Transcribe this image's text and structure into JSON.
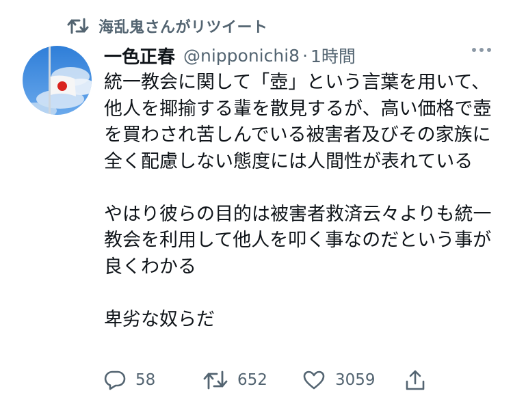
{
  "retweet_context": {
    "icon": "retweet-icon",
    "label": "海乱鬼さんがリツイート"
  },
  "author": {
    "avatar": "avatar-japanese-flag-on-pole",
    "display_name": "一色正春",
    "handle": "@nipponichi8",
    "separator": "·",
    "time": "1時間"
  },
  "more_menu": {
    "icon": "more-horizontal-icon"
  },
  "tweet": {
    "text": "統一教会に関して「壺」という言葉を用いて、他人を揶揄する輩を散見するが、高い価格で壺を買わされ苦しんでいる被害者及びその家族に全く配慮しない態度には人間性が表れている\n\nやはり彼らの目的は被害者救済云々よりも統一教会を利用して他人を叩く事なのだという事が良くわかる\n\n卑劣な奴らだ"
  },
  "actions": {
    "reply": {
      "icon": "reply-icon",
      "count": "58"
    },
    "retweet": {
      "icon": "retweet-icon",
      "count": "652"
    },
    "like": {
      "icon": "heart-icon",
      "count": "3059"
    },
    "share": {
      "icon": "share-icon"
    }
  },
  "colors": {
    "text_primary": "#0f1419",
    "text_secondary": "#536471"
  }
}
